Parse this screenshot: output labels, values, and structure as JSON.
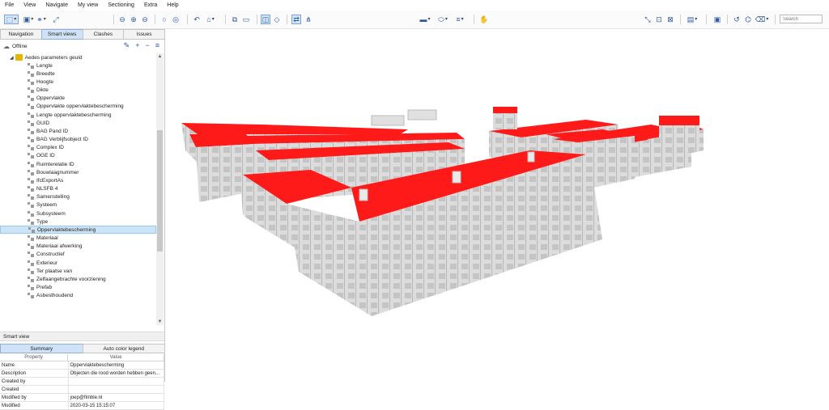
{
  "menu": [
    "File",
    "View",
    "Navigate",
    "My view",
    "Sectioning",
    "Extra",
    "Help"
  ],
  "toolbar": {
    "search_placeholder": "Search"
  },
  "panel": {
    "tabs": [
      "Navigation",
      "Smart views",
      "Clashes",
      "Issues"
    ],
    "status": "Offline",
    "group": "Aedes parameters geuld",
    "items": [
      "Lengte",
      "Breedte",
      "Hoogte",
      "Dikte",
      "Oppervlakte",
      "Oppervlakte oppervlaktebescherming",
      "Lengte oppervlaktebescherming",
      "GUID",
      "BAG Pand ID",
      "BAG Verblijfsobject ID",
      "Complex ID",
      "OGE ID",
      "Ruimterelatie ID",
      "Bouwlaagnummer",
      "IfcExportAs",
      "NLSFB 4",
      "Samenstelling",
      "Systeem",
      "Subsysteem",
      "Type",
      "Oppervlaktebescherming",
      "Materiaal",
      "Materiaal afwerking",
      "Constructief",
      "Exterieur",
      "Ter plaatse van",
      "Zelfaangebrachte voorziening",
      "Prefab",
      "Asbesthoudend"
    ],
    "selected_index": 20
  },
  "smart_view": {
    "label": "Smart view",
    "tabs": [
      "Summary",
      "Auto color legend"
    ],
    "columns": [
      "Property",
      "Value"
    ],
    "rows": [
      {
        "property": "Name",
        "value": "Oppervlaktebescherming"
      },
      {
        "property": "Description",
        "value": "Objecten die rood worden hebben geen..."
      },
      {
        "property": "Created by",
        "value": ""
      },
      {
        "property": "Created",
        "value": ""
      },
      {
        "property": "Modified by",
        "value": "joep@fimble.nl"
      },
      {
        "property": "Modified",
        "value": "2020-03-15 15:15:07"
      }
    ]
  },
  "colors": {
    "highlight": "#ff1a1a",
    "accent": "#2c5aa0",
    "selection": "#cce4f7"
  }
}
